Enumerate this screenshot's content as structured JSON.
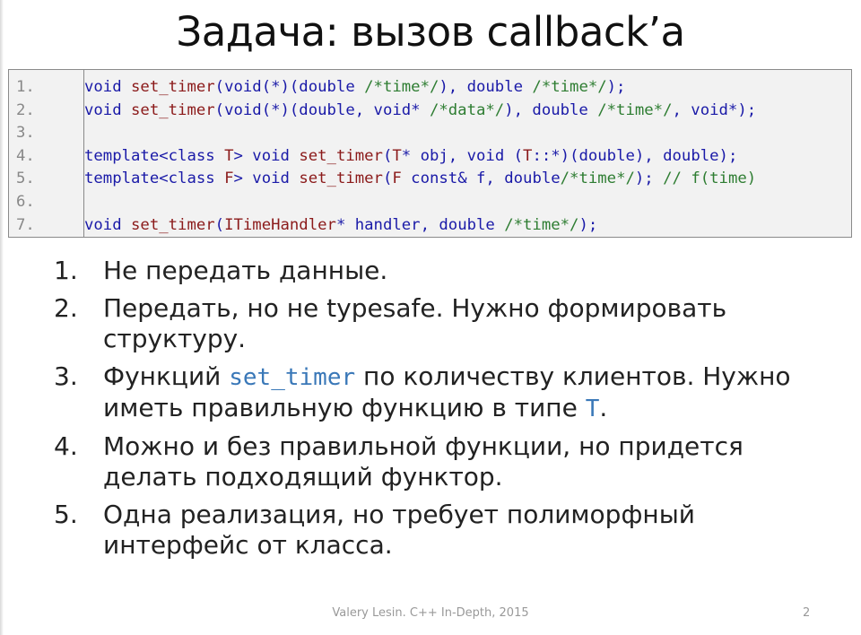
{
  "title": "Задача: вызов callback’a",
  "code": {
    "line_numbers": [
      "1.",
      "2.",
      "3.",
      "4.",
      "5.",
      "6.",
      "7."
    ],
    "lines": [
      [
        {
          "t": "kw",
          "s": "void "
        },
        {
          "t": "fn",
          "s": "set_timer"
        },
        {
          "t": "kw",
          "s": "(void(*)(double "
        },
        {
          "t": "cm",
          "s": "/*time*/"
        },
        {
          "t": "kw",
          "s": "), double "
        },
        {
          "t": "cm",
          "s": "/*time*/"
        },
        {
          "t": "kw",
          "s": ");"
        }
      ],
      [
        {
          "t": "kw",
          "s": "void "
        },
        {
          "t": "fn",
          "s": "set_timer"
        },
        {
          "t": "kw",
          "s": "(void(*)(double, void* "
        },
        {
          "t": "cm",
          "s": "/*data*/"
        },
        {
          "t": "kw",
          "s": "), double "
        },
        {
          "t": "cm",
          "s": "/*time*/"
        },
        {
          "t": "kw",
          "s": ", void*);"
        }
      ],
      [],
      [
        {
          "t": "kw",
          "s": "template<class "
        },
        {
          "t": "fn",
          "s": "T"
        },
        {
          "t": "kw",
          "s": "> void "
        },
        {
          "t": "fn",
          "s": "set_timer"
        },
        {
          "t": "kw",
          "s": "("
        },
        {
          "t": "fn",
          "s": "T"
        },
        {
          "t": "kw",
          "s": "* obj, void ("
        },
        {
          "t": "fn",
          "s": "T"
        },
        {
          "t": "kw",
          "s": "::*)(double), double);"
        }
      ],
      [
        {
          "t": "kw",
          "s": "template<class "
        },
        {
          "t": "fn",
          "s": "F"
        },
        {
          "t": "kw",
          "s": "> void "
        },
        {
          "t": "fn",
          "s": "set_timer"
        },
        {
          "t": "kw",
          "s": "("
        },
        {
          "t": "fn",
          "s": "F"
        },
        {
          "t": "kw",
          "s": " const& f, double"
        },
        {
          "t": "cm",
          "s": "/*time*/"
        },
        {
          "t": "kw",
          "s": "); "
        },
        {
          "t": "cm",
          "s": "// f(time)"
        }
      ],
      [],
      [
        {
          "t": "kw",
          "s": "void "
        },
        {
          "t": "fn",
          "s": "set_timer"
        },
        {
          "t": "kw",
          "s": "("
        },
        {
          "t": "fn",
          "s": "ITimeHandler"
        },
        {
          "t": "kw",
          "s": "* handler, double "
        },
        {
          "t": "cm",
          "s": "/*time*/"
        },
        {
          "t": "kw",
          "s": ");"
        }
      ]
    ]
  },
  "list": {
    "items": [
      {
        "num": "1.",
        "text": "Не передать данные."
      },
      {
        "num": "2.",
        "text": "Передать, но не typesafe. Нужно формировать структуру."
      },
      {
        "num": "3.",
        "pre": "Функций ",
        "code": "set_timer",
        "mid": " по количеству клиентов. Нужно иметь правильную функцию в типе ",
        "code2": "T",
        "post": "."
      },
      {
        "num": "4.",
        "text": "Можно и без правильной функции, но придется делать подходящий функтор."
      },
      {
        "num": "5.",
        "text": "Одна реализация, но требует полиморфный интерфейс от класса."
      }
    ]
  },
  "footer": {
    "text": "Valery Lesin. C++ In-Depth, 2015",
    "page": "2"
  },
  "colors": {
    "code_bg": "#f2f2f2",
    "keyword": "#1a1aa8",
    "function": "#8b1a1a",
    "comment": "#2e7d32",
    "inline_code": "#3a78b8"
  }
}
